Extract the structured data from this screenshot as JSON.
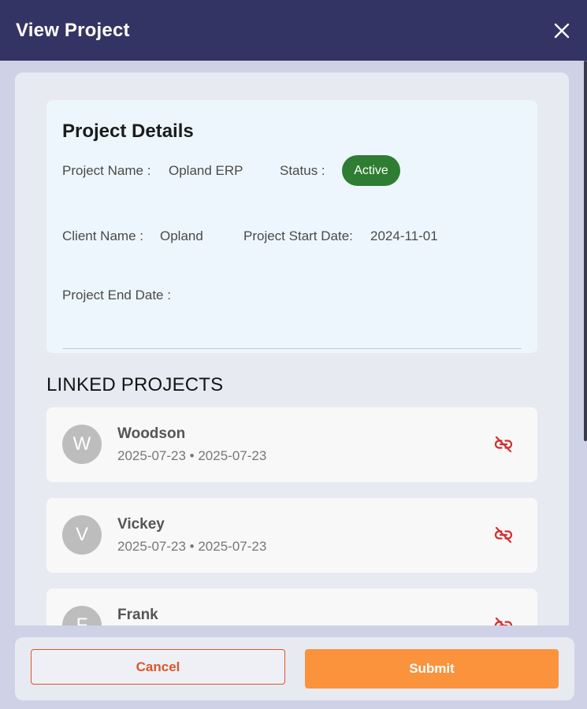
{
  "dialog": {
    "title": "View Project",
    "close_icon": "close-icon"
  },
  "details": {
    "heading": "Project Details",
    "project_name_label": "Project Name :",
    "project_name_value": "Opland ERP",
    "status_label": "Status :",
    "status_value": "Active",
    "status_color": "#2e7d32",
    "client_name_label": "Client Name :",
    "client_name_value": "Opland",
    "start_date_label": "Project Start Date:",
    "start_date_value": "2024-11-01",
    "end_date_label": "Project End Date :",
    "end_date_value": ""
  },
  "linked": {
    "heading": "LINKED PROJECTS",
    "unlink_icon": "unlink-icon",
    "items": [
      {
        "initial": "W",
        "name": "Woodson",
        "dates": "2025-07-23 • 2025-07-23"
      },
      {
        "initial": "V",
        "name": "Vickey",
        "dates": "2025-07-23 • 2025-07-23"
      },
      {
        "initial": "F",
        "name": "Frank",
        "dates": ""
      }
    ]
  },
  "footer": {
    "cancel_label": "Cancel",
    "submit_label": "Submit"
  },
  "colors": {
    "header": "#343464",
    "accent": "#fb923c",
    "cancel": "#d9572b",
    "unlink": "#d32f2f"
  }
}
